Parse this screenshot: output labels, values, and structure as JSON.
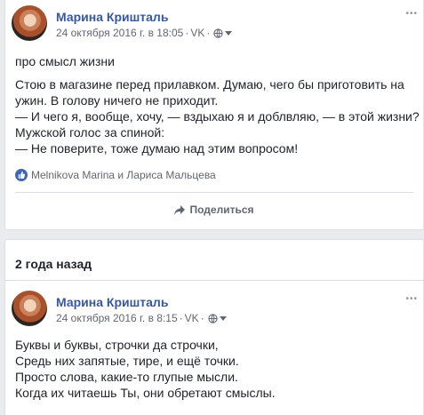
{
  "post1": {
    "author": "Марина Кришталь",
    "date": "24 октября 2016 г. в 18:05",
    "source": "VK",
    "lines": [
      "про смысл жизни",
      "",
      "Стою в магазине перед прилавком. Думаю, чего бы приготовить на",
      "ужин. В голову ничего не приходит.",
      "— И чего я, вообще, хочу, — вздыхаю я и доблвляю, — в этой жизни?",
      "Мужской голос за спиной:",
      "— Не поверите, тоже думаю над этим вопросом!"
    ],
    "reactions": "Melnikova Marina и Лариса Мальцева",
    "share_label": "Поделиться"
  },
  "memories": {
    "title": "2 года назад"
  },
  "post2": {
    "author": "Марина Кришталь",
    "date": "24 октября 2016 г. в 8:15",
    "source": "VK",
    "lines": [
      "Буквы и буквы, строчки да строчки,",
      "Средь них запятые, тире, и ещё точки.",
      "Просто слова, какие-то глупые мысли.",
      "Когда их читаешь Ты, они обретают смыслы."
    ]
  },
  "colors": {
    "link": "#385898",
    "like": "#4267b2",
    "background": "#e9ebee"
  },
  "icons": [
    "globe-icon",
    "caret-down-icon",
    "more-dots-icon",
    "like-icon",
    "share-arrow-icon"
  ]
}
